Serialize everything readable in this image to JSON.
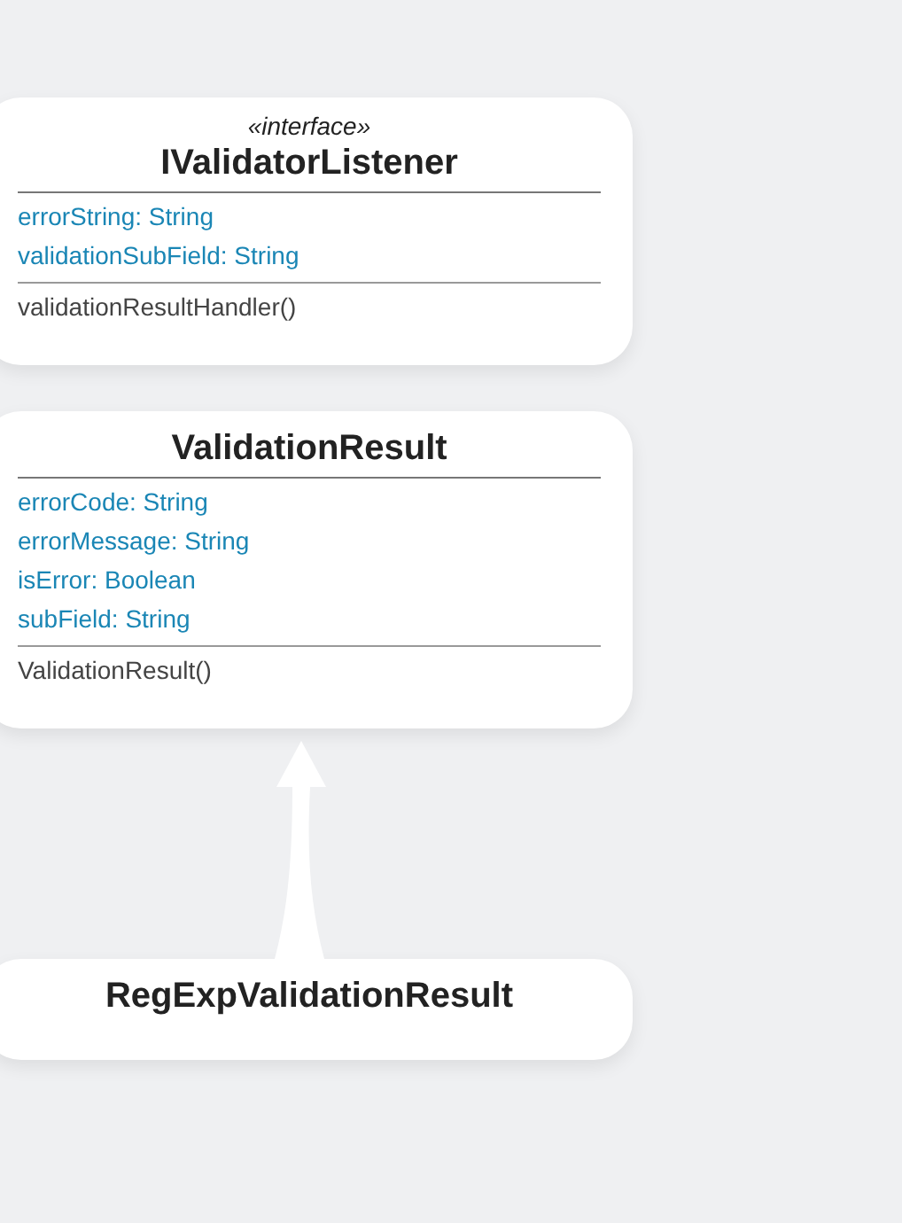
{
  "classes": [
    {
      "stereotype": "«interface»",
      "name": "IValidatorListener",
      "attributes": [
        "errorString: String",
        "validationSubField: String"
      ],
      "operations": [
        "validationResultHandler()"
      ]
    },
    {
      "name": "ValidationResult",
      "attributes": [
        "errorCode: String",
        "errorMessage: String",
        "isError: Boolean",
        "subField: String"
      ],
      "operations": [
        "ValidationResult()"
      ]
    },
    {
      "name": "RegExpValidationResult"
    }
  ]
}
